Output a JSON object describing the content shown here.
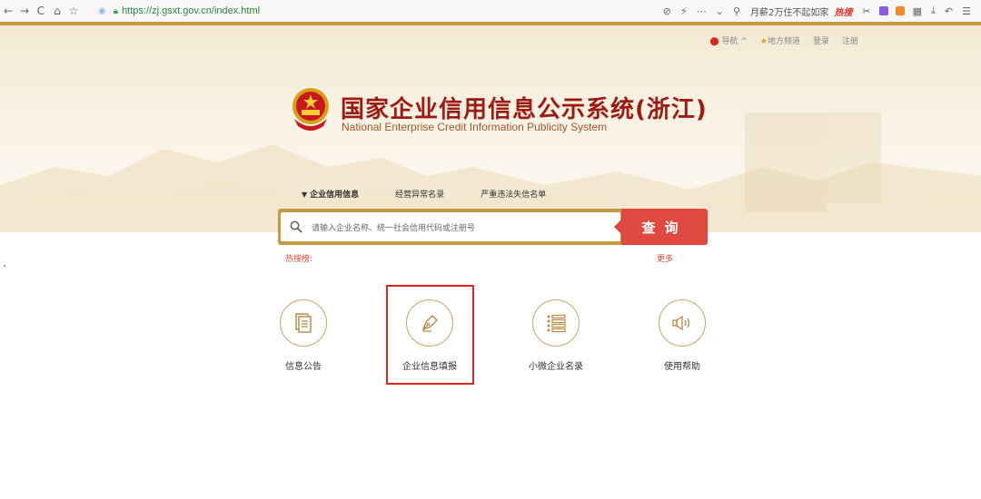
{
  "browser": {
    "url": "https://zj.gsxt.gov.cn/index.html",
    "search_text": "月薪2万住不起如家",
    "hot_badge": "热搜"
  },
  "topnav": {
    "nav_label": "导航",
    "local_label": "地方频道",
    "login_label": "登录",
    "register_label": "注册"
  },
  "header": {
    "title_cn": "国家企业信用信息公示系统(浙江)",
    "title_en": "National Enterprise Credit Information Publicity System"
  },
  "tabs": [
    {
      "label": "企业信用信息",
      "active": true
    },
    {
      "label": "经营异常名录",
      "active": false
    },
    {
      "label": "严重违法失信名单",
      "active": false
    }
  ],
  "search": {
    "placeholder": "请输入企业名称、统一社会信用代码或注册号",
    "button_label": "查询",
    "hot_label": "热搜榜:",
    "more_label": "更多"
  },
  "cards": [
    {
      "label": "信息公告",
      "icon": "document-icon"
    },
    {
      "label": "企业信息填报",
      "icon": "pen-icon"
    },
    {
      "label": "小微企业名录",
      "icon": "list-icon"
    },
    {
      "label": "使用帮助",
      "icon": "speaker-icon"
    }
  ],
  "colors": {
    "gold": "#c49a45",
    "red": "#e0493f",
    "title_red": "#9e1b13"
  }
}
